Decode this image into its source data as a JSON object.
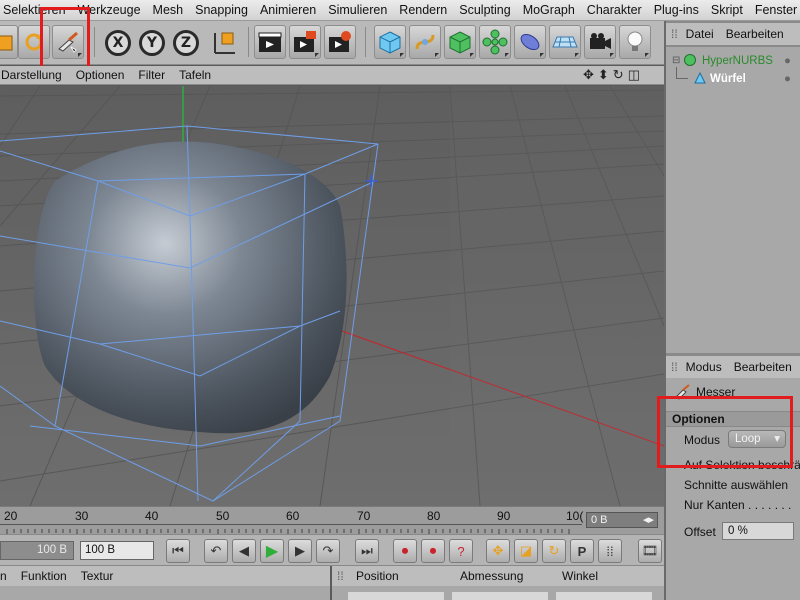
{
  "menubar": {
    "items": [
      "Selektieren",
      "Werkzeuge",
      "Mesh",
      "Snapping",
      "Animieren",
      "Simulieren",
      "Rendern",
      "Sculpting",
      "MoGraph",
      "Charakter",
      "Plug-ins",
      "Skript",
      "Fenster"
    ]
  },
  "toolbar": {
    "icons": [
      "cube-tool-icon",
      "rotate-tool-icon",
      "knife-tool-icon",
      "x-axis-lock-icon",
      "y-axis-lock-icon",
      "z-axis-lock-icon",
      "coordinate-system-icon",
      "render-view-icon",
      "render-to-picture-viewer-icon",
      "render-settings-icon",
      "cube-primitive-icon",
      "spline-pen-icon",
      "subdivision-icon",
      "array-icon",
      "deformer-icon",
      "floor-icon",
      "camera-icon",
      "light-icon"
    ],
    "x_label": "X",
    "y_label": "Y",
    "z_label": "Z"
  },
  "viewport": {
    "menu": [
      "Darstellung",
      "Optionen",
      "Filter",
      "Tafeln"
    ],
    "nav_icons": [
      "move-view-icon",
      "zoom-view-icon",
      "rotate-view-icon",
      "toggle-view-icon"
    ],
    "nav_glyphs": [
      "✥",
      "⬍",
      "↻",
      "◫"
    ]
  },
  "timeline": {
    "ticks": [
      "20",
      "30",
      "40",
      "50",
      "60",
      "70",
      "80",
      "90",
      "10("
    ],
    "current_frame": "0 B"
  },
  "transport": {
    "start_frame": "100 B",
    "end_frame": "100 B"
  },
  "materials": {
    "menu": [
      "n",
      "Funktion",
      "Textur"
    ]
  },
  "coordinates": {
    "headers": [
      "Position",
      "Abmessung",
      "Winkel"
    ]
  },
  "object_manager": {
    "menu": [
      "Datei",
      "Bearbeiten"
    ],
    "objects": [
      {
        "name": "HyperNURBS",
        "icon": "hypernurbs-icon"
      },
      {
        "name": "Würfel",
        "icon": "cube-object-icon"
      }
    ]
  },
  "attribute_manager": {
    "menu": [
      "Modus",
      "Bearbeiten"
    ],
    "tool_name": "Messer",
    "section": "Optionen",
    "modus_label": "Modus",
    "modus_value": "Loop",
    "rows": [
      "Auf Selektion beschrä",
      "Schnitte auswählen",
      "Nur Kanten . . . . . . ."
    ],
    "offset_label": "Offset",
    "offset_value": "0 %"
  },
  "colors": {
    "highlight": "#e21c1c",
    "wireframe": "#6f9ee8",
    "x_axis": "#c8232a",
    "y_axis": "#2fae3a",
    "selected_object": "#ffffff"
  }
}
